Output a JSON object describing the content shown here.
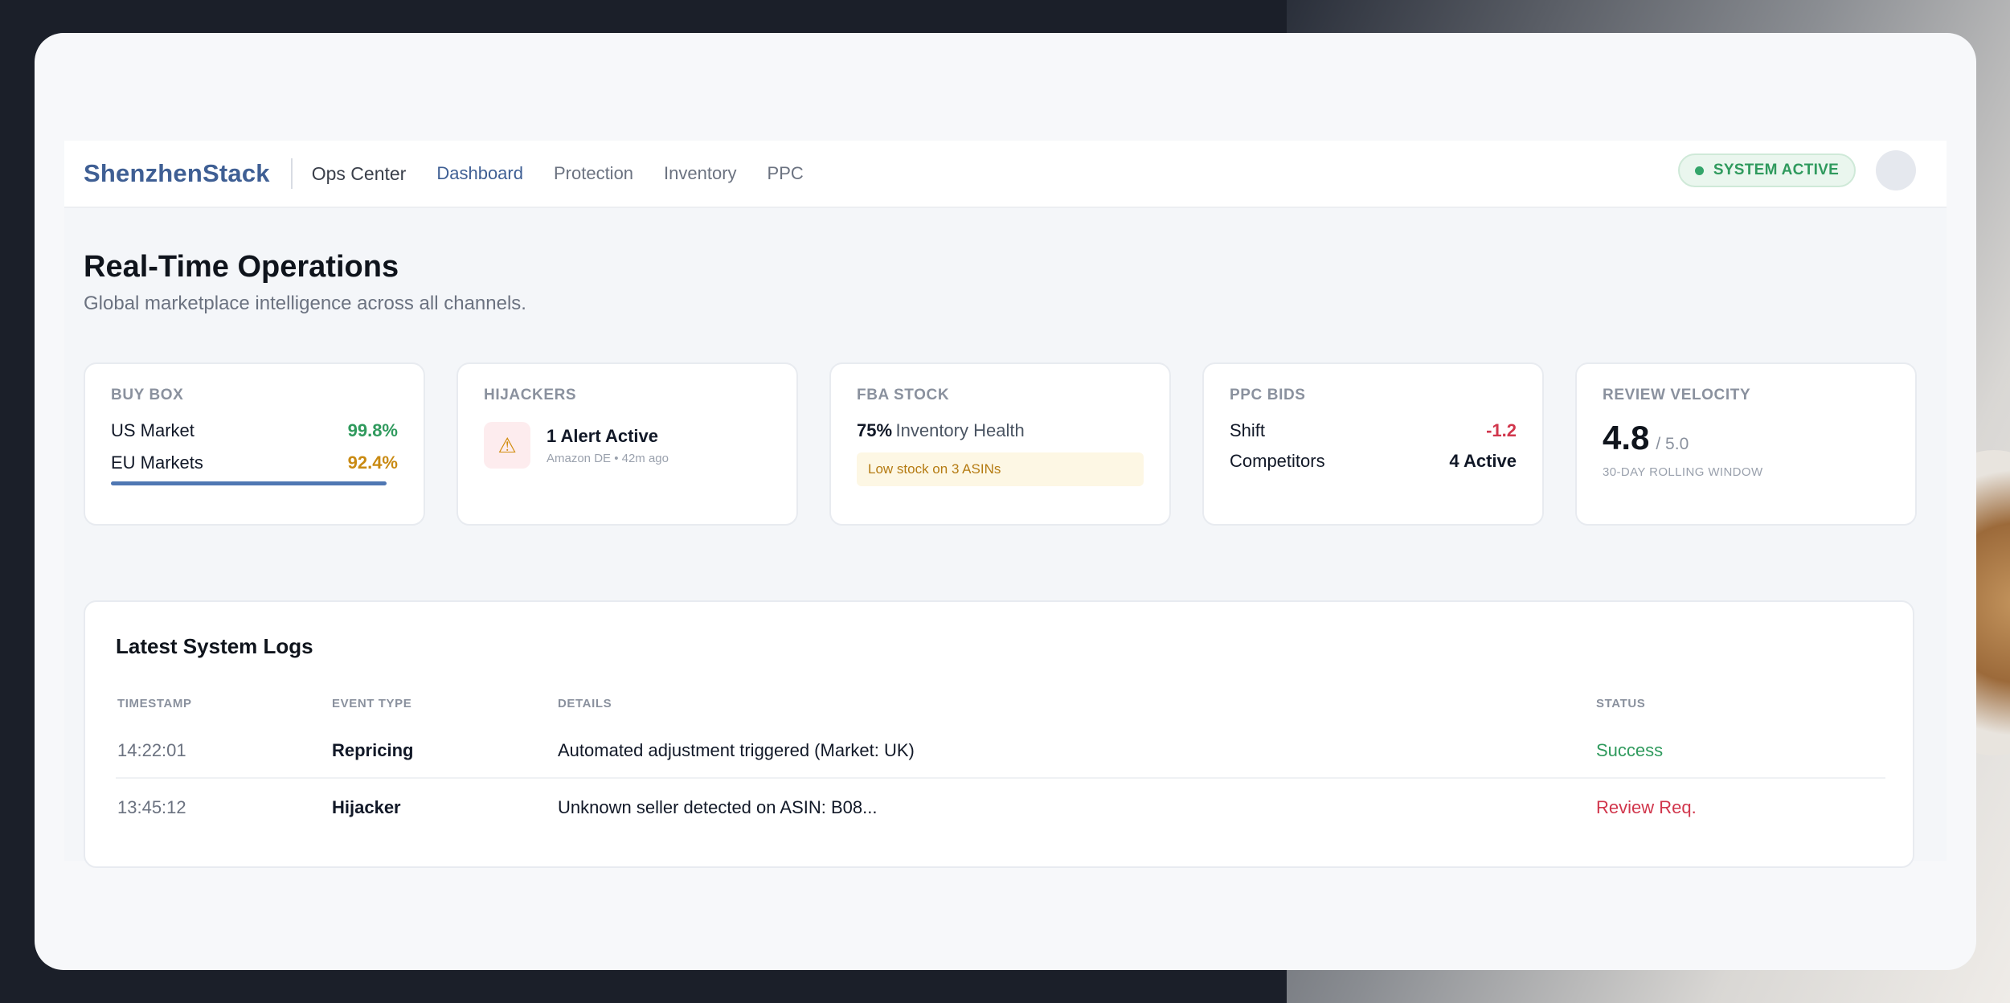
{
  "header": {
    "brand": "ShenzhenStack",
    "section": "Ops Center",
    "nav": [
      "Dashboard",
      "Protection",
      "Inventory",
      "PPC"
    ],
    "active_nav": "Dashboard",
    "status": "SYSTEM ACTIVE"
  },
  "page": {
    "title": "Real-Time Operations",
    "subtitle": "Global marketplace intelligence across all channels."
  },
  "cards": {
    "buybox": {
      "label": "BUY BOX",
      "rows": [
        {
          "name": "US Market",
          "value": "99.8%"
        },
        {
          "name": "EU Markets",
          "value": "92.4%"
        }
      ]
    },
    "hijackers": {
      "label": "HIJACKERS",
      "alert_title": "1 Alert Active",
      "alert_sub": "Amazon DE • 42m ago"
    },
    "fba": {
      "label": "FBA STOCK",
      "health_value": "75%",
      "health_label": "Inventory Health",
      "warning": "Low stock on 3 ASINs"
    },
    "ppc": {
      "label": "PPC BIDS",
      "rows": [
        {
          "name": "Shift",
          "value": "-1.2"
        },
        {
          "name": "Competitors",
          "value": "4 Active"
        }
      ]
    },
    "review": {
      "label": "REVIEW VELOCITY",
      "rating": "4.8",
      "rating_of": "/ 5.0",
      "window": "30-DAY ROLLING WINDOW"
    }
  },
  "logs": {
    "title": "Latest System Logs",
    "columns": [
      "TIMESTAMP",
      "EVENT TYPE",
      "DETAILS",
      "STATUS"
    ],
    "rows": [
      {
        "timestamp": "14:22:01",
        "event": "Repricing",
        "details": "Automated adjustment triggered (Market: UK)",
        "status": "Success"
      },
      {
        "timestamp": "13:45:12",
        "event": "Hijacker",
        "details": "Unknown seller detected on ASIN: B08...",
        "status": "Review Req."
      }
    ]
  },
  "colors": {
    "brand": "#3f5f94",
    "success": "#2f9a5d",
    "warning": "#c98a12",
    "danger": "#d1364c"
  }
}
